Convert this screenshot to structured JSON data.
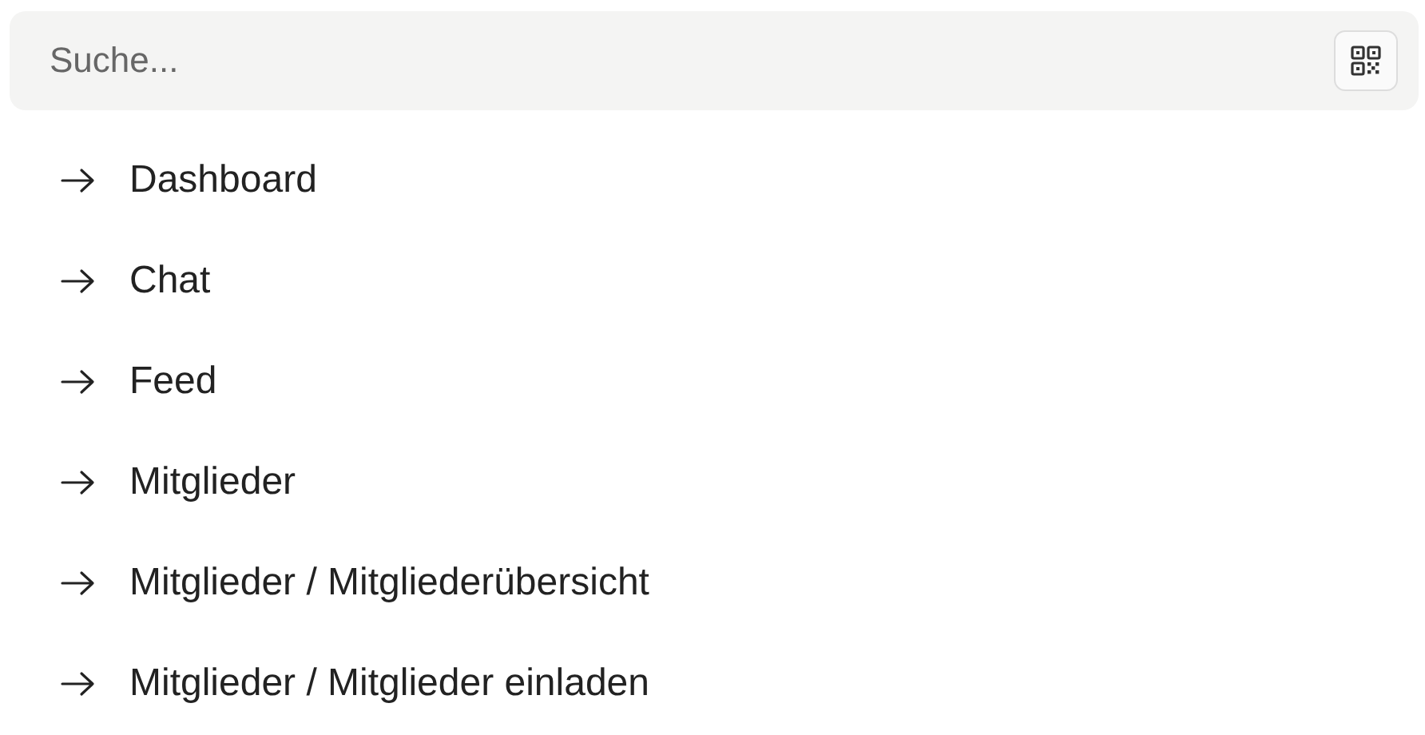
{
  "search": {
    "placeholder": "Suche..."
  },
  "results": [
    {
      "label": "Dashboard"
    },
    {
      "label": "Chat"
    },
    {
      "label": "Feed"
    },
    {
      "label": "Mitglieder"
    },
    {
      "label": "Mitglieder / Mitgliederübersicht"
    },
    {
      "label": "Mitglieder / Mitglieder einladen"
    }
  ]
}
